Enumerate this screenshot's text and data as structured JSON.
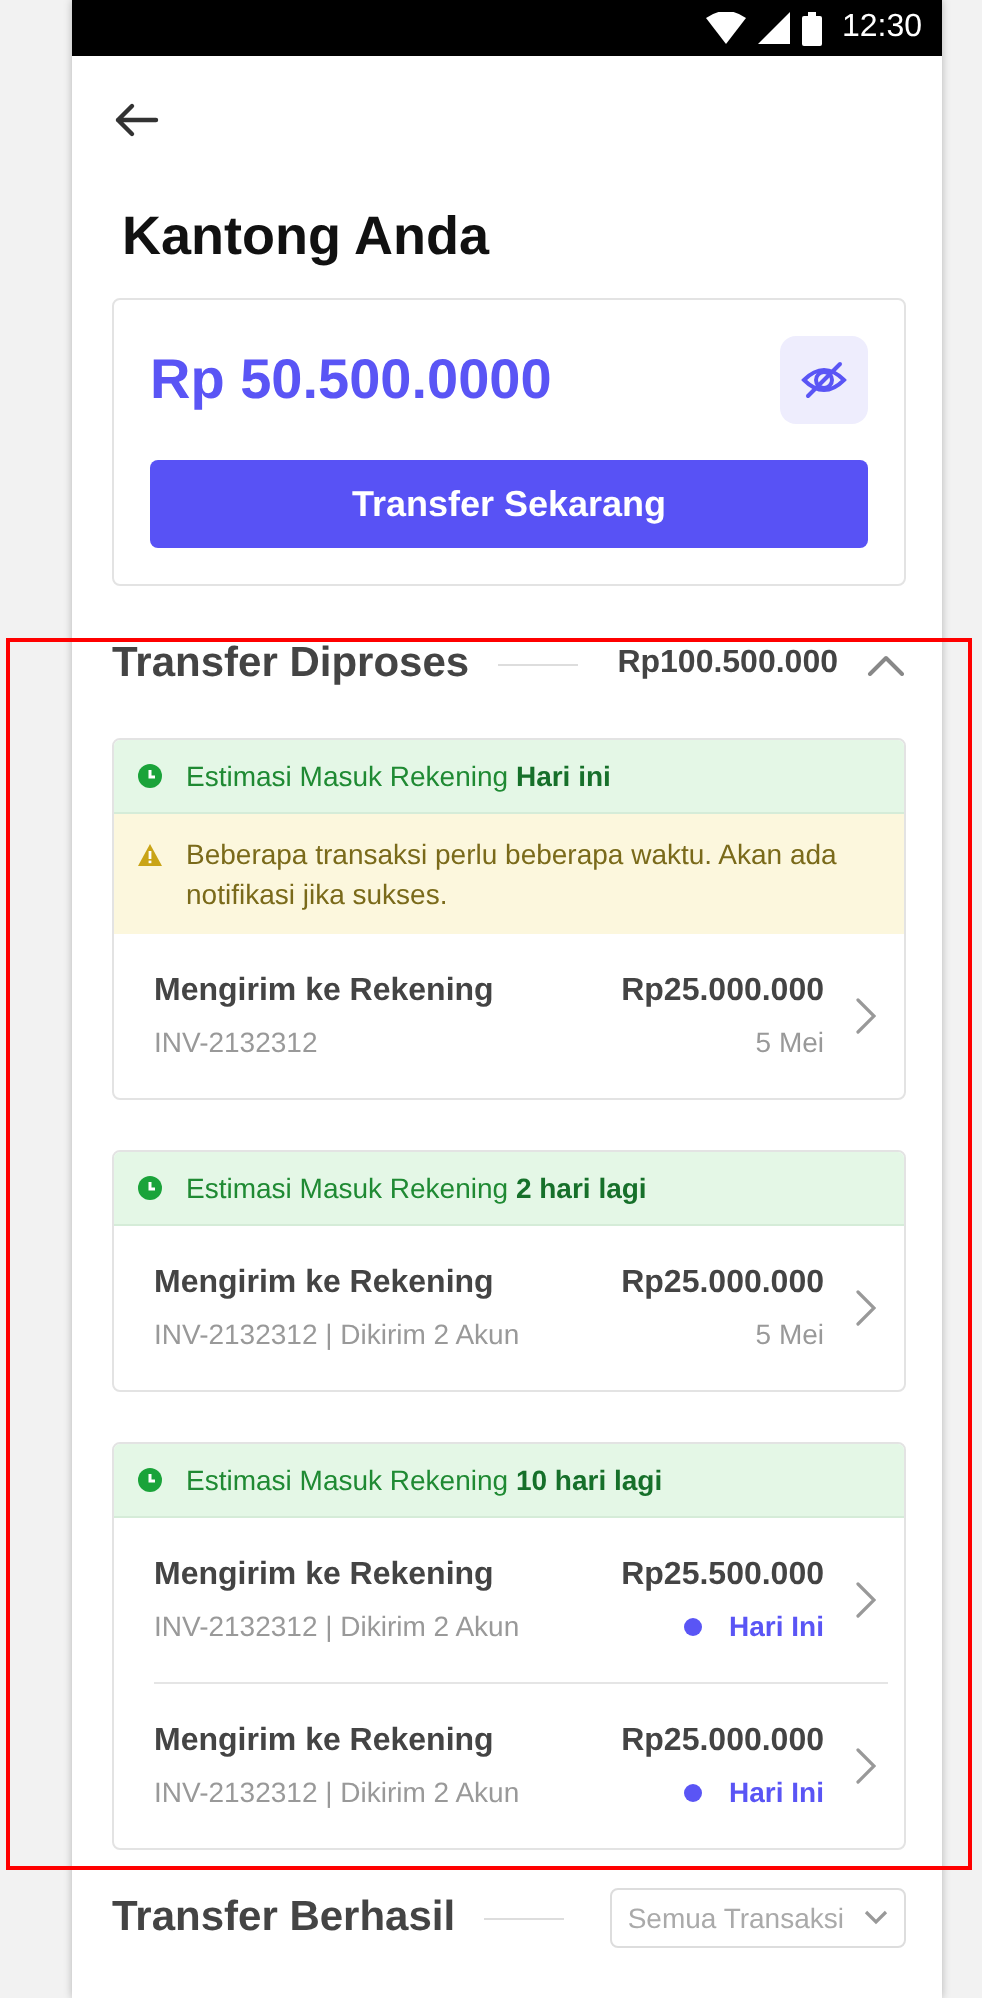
{
  "status_bar": {
    "time": "12:30"
  },
  "page": {
    "title": "Kantong Anda"
  },
  "balance": {
    "amount": "Rp 50.500.0000",
    "button": "Transfer Sekarang"
  },
  "processing": {
    "title": "Transfer Diproses",
    "total": "Rp100.500.000",
    "expanded": true,
    "highlighted": true,
    "groups": [
      {
        "estimate": "Estimasi Masuk Rekening **Hari ini**",
        "warning": "Beberapa transaksi perlu beberapa waktu. Akan ada notifikasi jika sukses.",
        "items": [
          {
            "title": "Mengirim ke Rekening",
            "amount": "Rp25.000.000",
            "reference": "INV-2132312",
            "date": "5 Mei",
            "kind": "plain"
          }
        ]
      },
      {
        "estimate": "Estimasi Masuk Rekening **2 hari lagi**",
        "items": [
          {
            "title": "Mengirim ke Rekening",
            "amount": "Rp25.000.000",
            "reference": "INV-2132312 | Dikirim 2 Akun",
            "date": "5 Mei",
            "kind": "plain"
          }
        ]
      },
      {
        "estimate": "Estimasi Masuk Rekening **10 hari lagi**",
        "items": [
          {
            "title": "Mengirim ke Rekening",
            "amount": "Rp25.500.000",
            "reference": "INV-2132312 | Dikirim 2 Akun",
            "date": "Hari Ini",
            "kind": "today"
          },
          {
            "title": "Mengirim ke Rekening",
            "amount": "Rp25.000.000",
            "reference": "INV-2132312 | Dikirim 2 Akun",
            "date": "Hari Ini",
            "kind": "today"
          }
        ]
      }
    ]
  },
  "completed": {
    "title": "Transfer Berhasil",
    "filter": "Semua Transaksi"
  }
}
